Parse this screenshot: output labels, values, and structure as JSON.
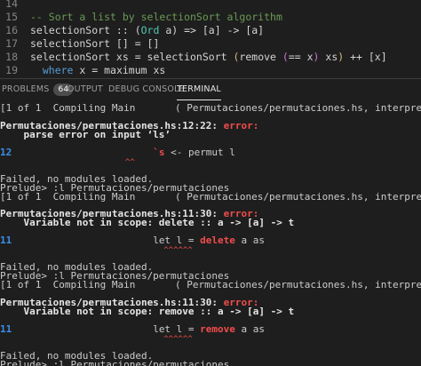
{
  "editor": {
    "lines": [
      {
        "num": "14",
        "parts": []
      },
      {
        "num": "15",
        "parts": [
          {
            "t": "-- Sort a list by selectionSort algorithm",
            "c": "c-comment"
          }
        ]
      },
      {
        "num": "16",
        "parts": [
          {
            "t": "selectionSort :: (",
            "c": "c-plain"
          },
          {
            "t": "Ord",
            "c": "c-type"
          },
          {
            "t": " a) => [a] -> [a]",
            "c": "c-plain"
          }
        ]
      },
      {
        "num": "17",
        "parts": [
          {
            "t": "selectionSort [] = []",
            "c": "c-plain"
          }
        ]
      },
      {
        "num": "18",
        "parts": [
          {
            "t": "selectionSort xs = selectionSort ",
            "c": "c-plain"
          },
          {
            "t": "(",
            "c": "c-paren"
          },
          {
            "t": "remove ",
            "c": "c-plain"
          },
          {
            "t": "(",
            "c": "c-br"
          },
          {
            "t": "== x",
            "c": "c-plain"
          },
          {
            "t": ")",
            "c": "c-br"
          },
          {
            "t": " xs",
            "c": "c-plain"
          },
          {
            "t": ")",
            "c": "c-paren"
          },
          {
            "t": " ++ [x]",
            "c": "c-plain"
          }
        ]
      },
      {
        "num": "19",
        "parts": [
          {
            "t": "  ",
            "c": "c-plain"
          },
          {
            "t": "where",
            "c": "c-kw"
          },
          {
            "t": " x = maximum xs",
            "c": "c-plain"
          }
        ]
      }
    ]
  },
  "panel": {
    "tabs": [
      {
        "label": "PROBLEMS",
        "badge": "64"
      },
      {
        "label": "OUTPUT"
      },
      {
        "label": "DEBUG CONSOLE"
      },
      {
        "label": "TERMINAL"
      }
    ],
    "active": "TERMINAL"
  },
  "terminal": {
    "lines": [
      {
        "parts": [
          {
            "t": "[1 of 1  Compiling Main",
            "c": ""
          }
        ],
        "right": "( Permutaciones/permutaciones.hs, interpreted )"
      },
      {
        "parts": []
      },
      {
        "parts": [
          {
            "t": "Permutaciones/permutaciones.hs:12:22: ",
            "c": "bold"
          },
          {
            "t": "error:",
            "c": "err"
          }
        ]
      },
      {
        "parts": [
          {
            "t": "    parse error on input ‘ls’",
            "c": "bold"
          }
        ]
      },
      {
        "parts": []
      },
      {
        "parts": [
          {
            "t": "12",
            "c": "blue"
          },
          {
            "t": "                        ",
            "c": ""
          },
          {
            "t": "`s",
            "c": "redtxt"
          },
          {
            "t": " <- permut l",
            "c": ""
          }
        ]
      },
      {
        "parts": [
          {
            "t": "                          ^^",
            "c": "squig"
          }
        ]
      },
      {
        "parts": []
      },
      {
        "parts": [
          {
            "t": "Failed, no modules loaded.",
            "c": ""
          }
        ]
      },
      {
        "parts": [
          {
            "t": "Prelude> :l Permutaciones/permutaciones",
            "c": ""
          }
        ]
      },
      {
        "parts": [
          {
            "t": "[1 of 1  Compiling Main",
            "c": ""
          }
        ],
        "right": "( Permutaciones/permutaciones.hs, interpreted )"
      },
      {
        "parts": []
      },
      {
        "parts": [
          {
            "t": "Permutaciones/permutaciones.hs:11:30: ",
            "c": "bold"
          },
          {
            "t": "error:",
            "c": "err"
          }
        ]
      },
      {
        "parts": [
          {
            "t": "    Variable not in scope: delete :: a -> [a] -> t",
            "c": "bold"
          }
        ]
      },
      {
        "parts": []
      },
      {
        "parts": [
          {
            "t": "11",
            "c": "blue"
          },
          {
            "t": "                        let l = ",
            "c": ""
          },
          {
            "t": "delete",
            "c": "redtxt"
          },
          {
            "t": " a as",
            "c": ""
          }
        ]
      },
      {
        "parts": [
          {
            "t": "                                  ^^^^^^",
            "c": "squig"
          }
        ]
      },
      {
        "parts": []
      },
      {
        "parts": [
          {
            "t": "Failed, no modules loaded.",
            "c": ""
          }
        ]
      },
      {
        "parts": [
          {
            "t": "Prelude> :l Permutaciones/permutaciones",
            "c": ""
          }
        ]
      },
      {
        "parts": [
          {
            "t": "[1 of 1  Compiling Main",
            "c": ""
          }
        ],
        "right": "( Permutaciones/permutaciones.hs, interpreted )"
      },
      {
        "parts": []
      },
      {
        "parts": [
          {
            "t": "Permutaciones/permutaciones.hs:11:30: ",
            "c": "bold"
          },
          {
            "t": "error:",
            "c": "err"
          }
        ]
      },
      {
        "parts": [
          {
            "t": "    Variable not in scope: remove :: a -> [a] -> t",
            "c": "bold"
          }
        ]
      },
      {
        "parts": []
      },
      {
        "parts": [
          {
            "t": "11",
            "c": "blue"
          },
          {
            "t": "                        let l = ",
            "c": ""
          },
          {
            "t": "remove",
            "c": "redtxt"
          },
          {
            "t": " a as",
            "c": ""
          }
        ]
      },
      {
        "parts": [
          {
            "t": "                                  ^^^^^^",
            "c": "squig"
          }
        ]
      },
      {
        "parts": []
      },
      {
        "parts": [
          {
            "t": "Failed, no modules loaded.",
            "c": ""
          }
        ]
      },
      {
        "parts": [
          {
            "t": "Prelude> :l Permutaciones/permutaciones",
            "c": ""
          }
        ]
      }
    ]
  }
}
